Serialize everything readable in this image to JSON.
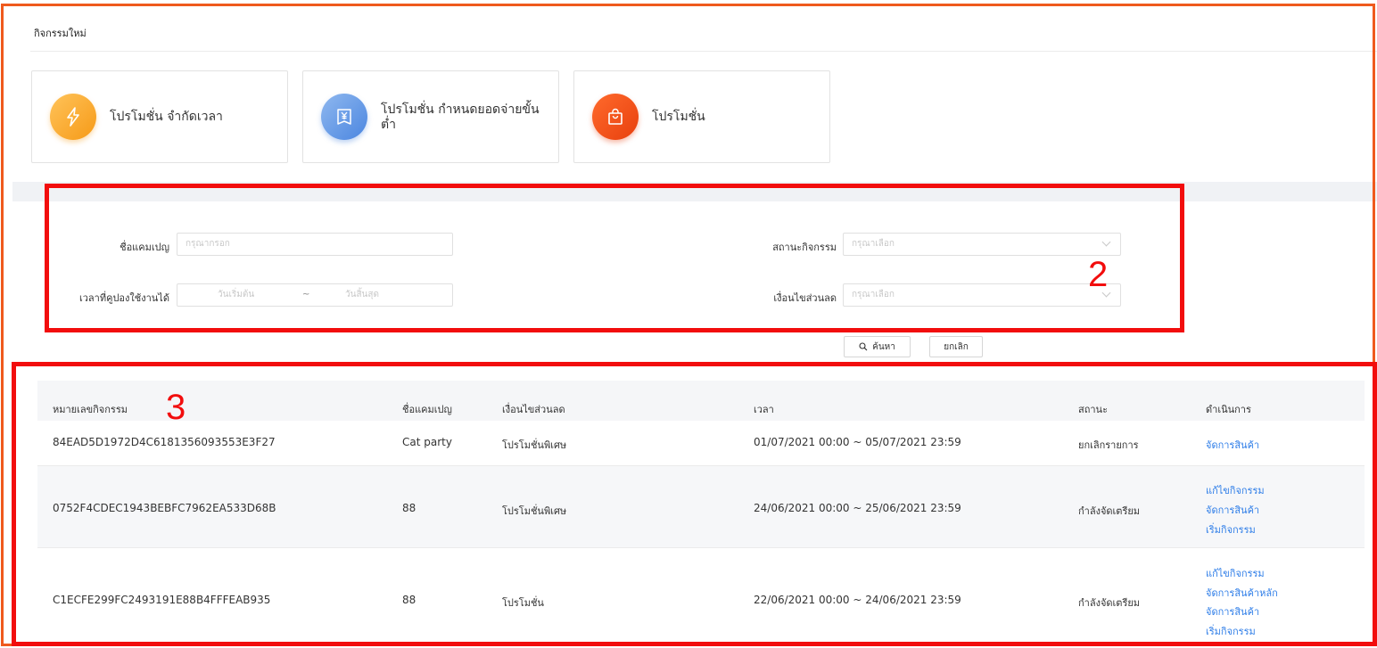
{
  "section": {
    "title": "กิจกรรมใหม่"
  },
  "cards": [
    {
      "label": "โปรโมชั่น จำกัดเวลา",
      "icon": "lightning-icon",
      "color": "#f69a17"
    },
    {
      "label": "โปรโมชั่น กำหนดยอดจ่ายขั้นต่ำ",
      "icon": "yen-voucher-icon",
      "color": "#4b86e0"
    },
    {
      "label": "โปรโมชั่น",
      "icon": "shopping-bag-icon",
      "color": "#e8400e"
    }
  ],
  "form": {
    "campaign_name_label": "ชื่อแคมเปญ",
    "campaign_name_placeholder": "กรุณากรอก",
    "status_label": "สถานะกิจกรรม",
    "status_placeholder": "กรุณาเลือก",
    "coupon_time_label": "เวลาที่คูปองใช้งานได้",
    "start_placeholder": "วันเริ่มต้น",
    "range_sep": "~",
    "end_placeholder": "วันสิ้นสุด",
    "discount_label": "เงื่อนไขส่วนลด",
    "discount_placeholder": "กรุณาเลือก",
    "search_label": "ค้นหา",
    "cancel_label": "ยกเลิก"
  },
  "table": {
    "headers": [
      "หมายเลขกิจกรรม",
      "ชื่อแคมเปญ",
      "เงื่อนไขส่วนลด",
      "เวลา",
      "สถานะ",
      "ดำเนินการ"
    ],
    "rows": [
      {
        "id": "84EAD5D1972D4C6181356093553E3F27",
        "name": "Cat party",
        "condition": "โปรโมชั่นพิเศษ",
        "time": "01/07/2021 00:00 ~ 05/07/2021 23:59",
        "status": "ยกเลิกรายการ",
        "actions": [
          "จัดการสินค้า"
        ]
      },
      {
        "id": "0752F4CDEC1943BEBFC7962EA533D68B",
        "name": "88",
        "condition": "โปรโมชั่นพิเศษ",
        "time": "24/06/2021 00:00 ~ 25/06/2021 23:59",
        "status": "กำลังจัดเตรียม",
        "actions": [
          "แก้ไขกิจกรรม",
          "จัดการสินค้า",
          "เริ่มกิจกรรม"
        ]
      },
      {
        "id": "C1ECFE299FC2493191E88B4FFFEAB935",
        "name": "88",
        "condition": "โปรโมชั่น",
        "time": "22/06/2021 00:00 ~ 24/06/2021 23:59",
        "status": "กำลังจัดเตรียม",
        "actions": [
          "แก้ไขกิจกรรม",
          "จัดการสินค้าหลัก",
          "จัดการสินค้า",
          "เริ่มกิจกรรม"
        ]
      }
    ]
  },
  "annotations": {
    "box2": "2",
    "box3": "3"
  },
  "colors": {
    "link": "#2f7ee8",
    "annotation_red": "#f20d0d",
    "annotation_orange": "#ef5a1d"
  }
}
